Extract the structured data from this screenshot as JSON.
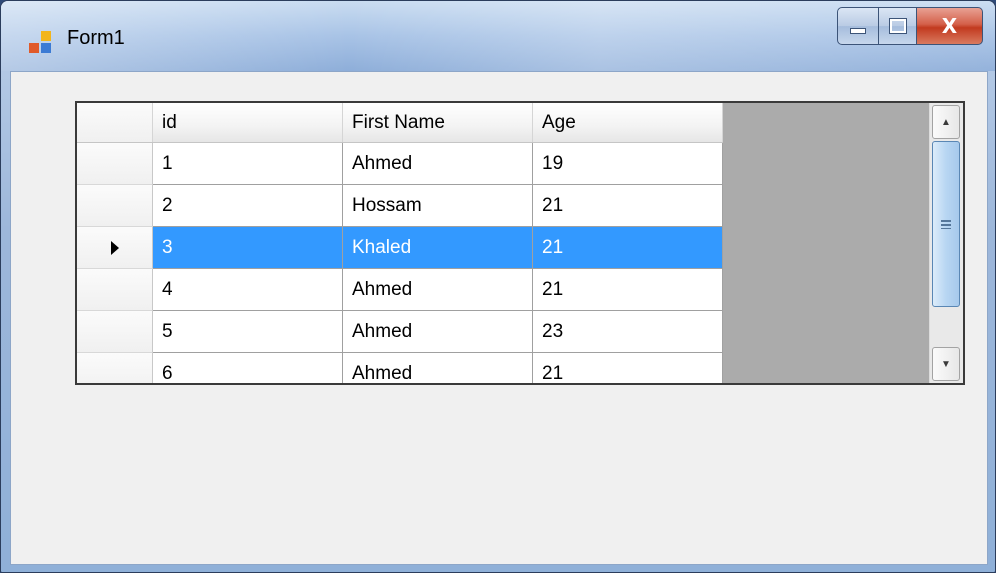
{
  "window": {
    "title": "Form1",
    "buttons": {
      "minimize": "—",
      "maximize": "▢",
      "close": "X"
    }
  },
  "grid": {
    "columns": [
      "id",
      "First Name",
      "Age"
    ],
    "rows": [
      {
        "id": "1",
        "first_name": "Ahmed",
        "age": "19"
      },
      {
        "id": "2",
        "first_name": "Hossam",
        "age": "21"
      },
      {
        "id": "3",
        "first_name": "Khaled",
        "age": "21"
      },
      {
        "id": "4",
        "first_name": "Ahmed",
        "age": "21"
      },
      {
        "id": "5",
        "first_name": "Ahmed",
        "age": "23"
      },
      {
        "id": "6",
        "first_name": "Ahmed",
        "age": "21"
      }
    ],
    "selected_row_index": 2,
    "scrollbar": {
      "up_arrow": "▲",
      "down_arrow": "▼"
    }
  },
  "colors": {
    "selection": "#3399ff",
    "empty_area": "#ababab",
    "client_background": "#f0f0f0"
  }
}
